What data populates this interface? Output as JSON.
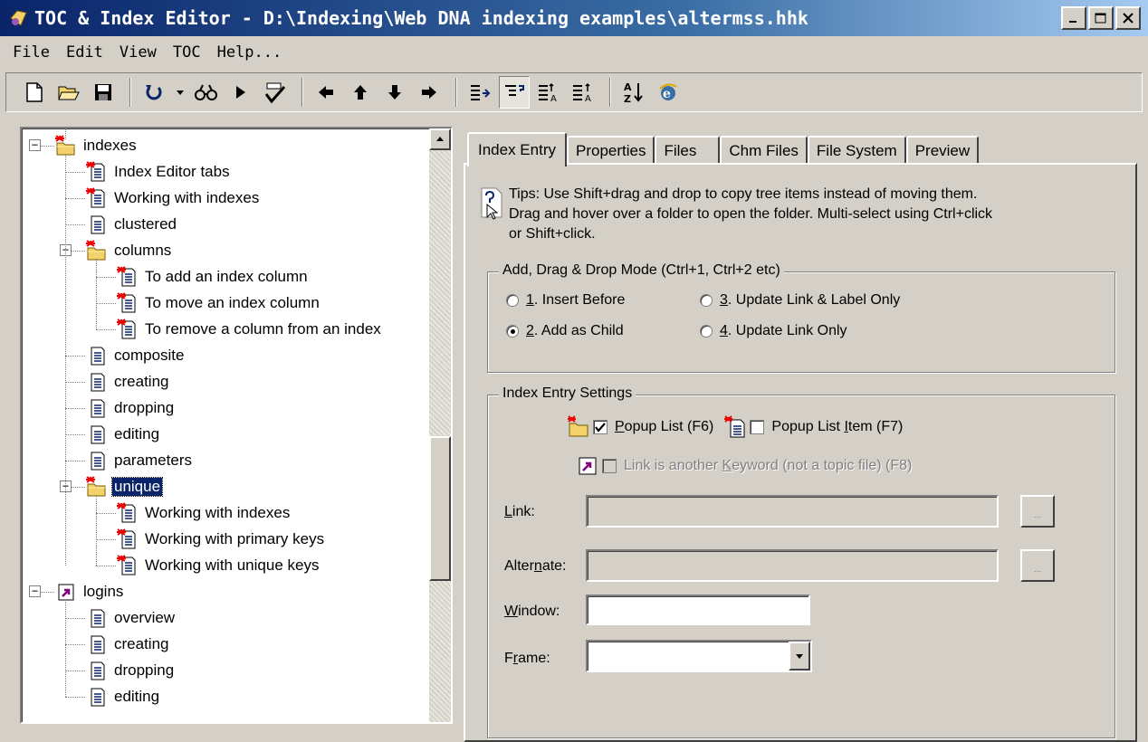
{
  "window": {
    "title": "TOC & Index Editor - D:\\Indexing\\Web DNA indexing examples\\altermss.hhk",
    "minimize": "_",
    "maximize": "□",
    "close": "✕"
  },
  "menu": [
    {
      "label": "File"
    },
    {
      "label": "Edit"
    },
    {
      "label": "View"
    },
    {
      "label": "TOC"
    },
    {
      "label": "Help..."
    }
  ],
  "tree": {
    "rows": [
      {
        "label": "indexes"
      },
      {
        "label": "Index Editor tabs"
      },
      {
        "label": "Working with indexes"
      },
      {
        "label": "clustered"
      },
      {
        "label": "columns"
      },
      {
        "label": "To add an index column"
      },
      {
        "label": "To move an index column"
      },
      {
        "label": "To remove a column from an index"
      },
      {
        "label": "composite"
      },
      {
        "label": "creating"
      },
      {
        "label": "dropping"
      },
      {
        "label": "editing"
      },
      {
        "label": "parameters"
      },
      {
        "label": "unique"
      },
      {
        "label": "Working with indexes"
      },
      {
        "label": "Working with primary keys"
      },
      {
        "label": "Working with unique keys"
      },
      {
        "label": "logins"
      },
      {
        "label": "overview"
      },
      {
        "label": "creating"
      },
      {
        "label": "dropping"
      },
      {
        "label": "editing"
      }
    ]
  },
  "tabs": [
    "Index Entry",
    "Properties",
    "Files",
    "Chm Files",
    "File System",
    "Preview"
  ],
  "tips": {
    "line1": "Tips:  Use Shift+drag and drop to copy tree items instead of moving them.",
    "line2": "Drag and hover over a folder to open the folder. Multi-select using Ctrl+click",
    "line3": "or Shift+click."
  },
  "mode_group": {
    "title": "Add, Drag & Drop Mode (Ctrl+1, Ctrl+2 etc)",
    "opt1_key": "1",
    "opt1_rest": ". Insert Before",
    "opt2_key": "2",
    "opt2_rest": ". Add as Child",
    "opt3_key": "3",
    "opt3_rest": ". Update Link & Label Only",
    "opt4_key": "4",
    "opt4_rest": ". Update Link Only"
  },
  "settings_group": {
    "title": "Index Entry Settings",
    "popup_list_key": "P",
    "popup_list_rest": "opup List (F6)",
    "popup_item_pre": "Popup List ",
    "popup_item_key": "I",
    "popup_item_rest": "tem (F7)",
    "keyword_pre": "Link is another ",
    "keyword_key": "K",
    "keyword_rest": "eyword (not a topic file) (F8)",
    "link_key": "L",
    "link_rest": "ink:",
    "alternate_pre": "Alter",
    "alternate_key": "n",
    "alternate_rest": "ate:",
    "window_key": "W",
    "window_rest": "indow:",
    "frame_pre": "F",
    "frame_key": "r",
    "frame_rest": "ame:",
    "browse": "..."
  }
}
